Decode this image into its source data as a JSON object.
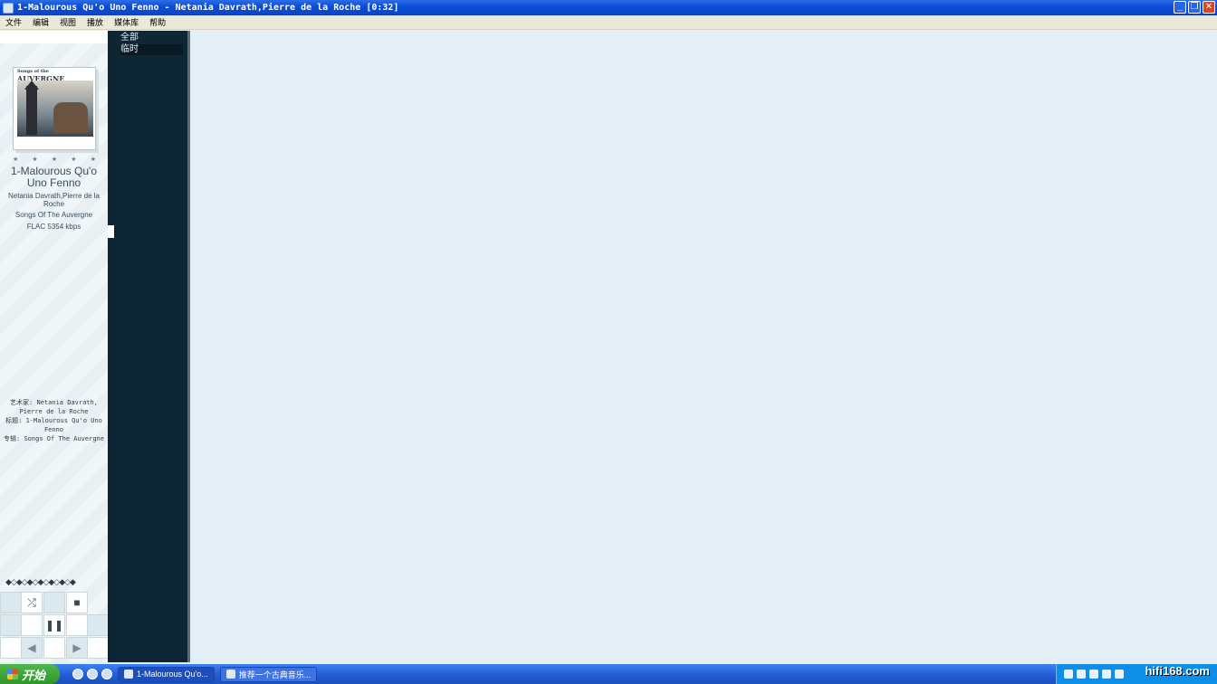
{
  "window": {
    "title": "1-Malourous Qu'o Uno Fenno - Netania Davrath,Pierre de la Roche [0:32]"
  },
  "menu": [
    "文件",
    "编辑",
    "视图",
    "播放",
    "媒体库",
    "帮助"
  ],
  "now_playing": {
    "cover_text": "AUVERGNE",
    "cover_subtext": "Songs of the",
    "title": "1-Malourous Qu'o Uno Fenno",
    "artist": "Netania Davrath,Pierre de la Roche",
    "album": "Songs Of The Auvergne",
    "format": "FLAC  5354 kbps",
    "rating": 0
  },
  "info": {
    "artist_line": "艺术家: Netania Davrath,",
    "artist_line2": "Pierre de la Roche",
    "title_line": "标题: 1-Malourous Qu'o Uno",
    "title_line2": "Fenno",
    "album_line": "专辑: Songs Of The Auvergne"
  },
  "playlists": [
    "全部",
    "临时"
  ],
  "taskbar": {
    "start_label": "开始",
    "tasks": [
      "1-Malourous Qu'o...",
      "推荐一个古典音乐..."
    ],
    "watermark": "hifi168.com"
  }
}
